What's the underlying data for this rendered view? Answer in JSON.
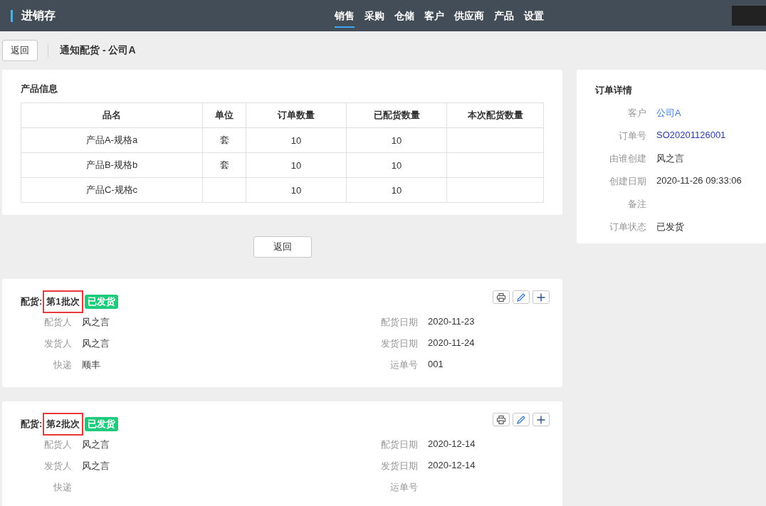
{
  "app": {
    "title": "进销存"
  },
  "nav": [
    {
      "label": "销售",
      "selected": true
    },
    {
      "label": "采购",
      "selected": false
    },
    {
      "label": "仓储",
      "selected": false
    },
    {
      "label": "客户",
      "selected": false
    },
    {
      "label": "供应商",
      "selected": false
    },
    {
      "label": "产品",
      "selected": false
    },
    {
      "label": "设置",
      "selected": false
    }
  ],
  "toolbar": {
    "back": "返回",
    "title": "通知配货 - 公司A"
  },
  "product_card": {
    "title": "产品信息",
    "columns": [
      "品名",
      "单位",
      "订单数量",
      "已配货数量",
      "本次配货数量"
    ],
    "rows": [
      [
        "产品A-规格a",
        "套",
        "10",
        "10",
        null
      ],
      [
        "产品B-规格b",
        "套",
        "10",
        "10",
        null
      ],
      [
        "产品C-规格c",
        null,
        "10",
        "10",
        null
      ]
    ]
  },
  "back_button": "返回",
  "batches": [
    {
      "label": "配货:",
      "name": "第1批次",
      "highlighted": true,
      "status": "已发货",
      "fields": [
        {
          "label": "配货人",
          "value": "风之言"
        },
        {
          "label": "配货日期",
          "value": "2020-11-23"
        },
        {
          "label": "发货人",
          "value": "风之言"
        },
        {
          "label": "发货日期",
          "value": "2020-11-24"
        },
        {
          "label": "快递",
          "value": "顺丰"
        },
        {
          "label": "运单号",
          "value": "001"
        }
      ]
    },
    {
      "label": "配货:",
      "name": "第2批次",
      "highlighted": true,
      "status": "已发货",
      "fields": [
        {
          "label": "配货人",
          "value": "风之言"
        },
        {
          "label": "配货日期",
          "value": "2020-12-14"
        },
        {
          "label": "发货人",
          "value": "风之言"
        },
        {
          "label": "发货日期",
          "value": "2020-12-14"
        },
        {
          "label": "快递"
        },
        {
          "label": "运单号"
        }
      ]
    }
  ],
  "order": {
    "title": "订单详情",
    "rows": [
      {
        "label": "客户",
        "value": "公司A",
        "kind": "link"
      },
      {
        "label": "订单号",
        "value": "SO20201126001",
        "kind": "code"
      },
      {
        "label": "由谁创建",
        "value": "风之言",
        "kind": "text"
      },
      {
        "label": "创建日期",
        "value": "2020-11-26 09:33:06",
        "kind": "text"
      },
      {
        "label": "备注"
      },
      {
        "label": "订单状态",
        "value": "已发货",
        "kind": "text"
      }
    ]
  }
}
